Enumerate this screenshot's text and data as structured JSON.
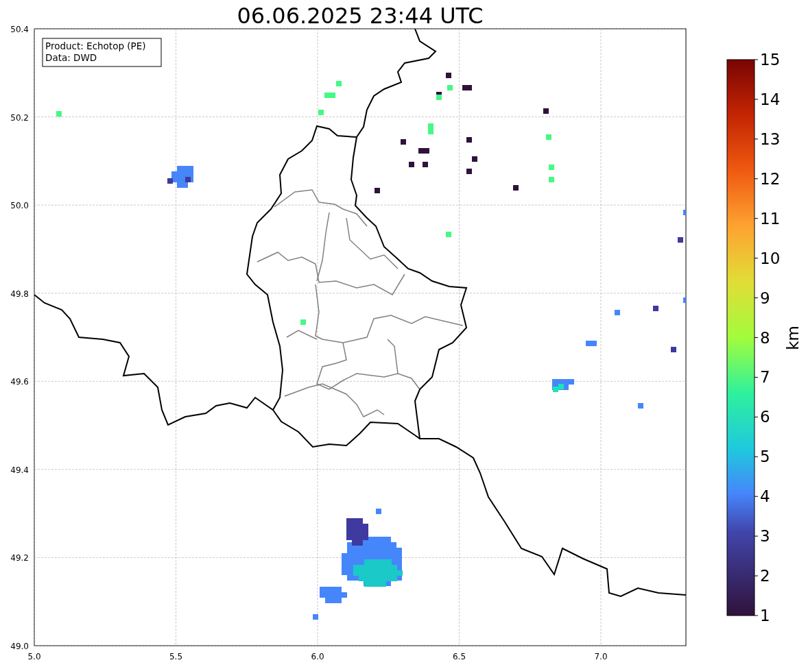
{
  "title": "06.06.2025 23:44 UTC",
  "info_box": [
    "Product: Echotop (PE)",
    "Data: DWD"
  ],
  "map": {
    "xticks": [
      "5.0",
      "5.5",
      "6.0",
      "6.5",
      "7.0"
    ],
    "yticks": [
      "50.4",
      "50.2",
      "50.0",
      "49.8",
      "49.6",
      "49.4",
      "49.2",
      "49.0"
    ]
  },
  "colorbar": {
    "label": "km",
    "ticks": [
      "15",
      "14",
      "13",
      "12",
      "11",
      "10",
      "9",
      "8",
      "7",
      "6",
      "5",
      "4",
      "3",
      "2",
      "1"
    ]
  }
}
